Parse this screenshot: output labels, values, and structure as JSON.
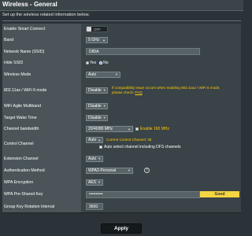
{
  "header": {
    "title": "Wireless - General"
  },
  "subtitle": "Set up the wireless related information below.",
  "rows": {
    "smart_connect": {
      "label": "Enable Smart Connect",
      "toggle_text": "OFF"
    },
    "band": {
      "label": "Band",
      "value": "5 GHz"
    },
    "ssid": {
      "label": "Network Name (SSID)",
      "value": "D85A"
    },
    "hide_ssid": {
      "label": "Hide SSID",
      "yes": "Yes",
      "no": "No",
      "selected": "No"
    },
    "wireless_mode": {
      "label": "Wireless Mode",
      "value": "Auto"
    },
    "wifi6": {
      "label": "802.11ax / WiFi 6 mode",
      "value": "Disable",
      "warning": "If compatibility issue occurs when enabling 802.11ax / WiFi 6 mode, please check:",
      "faq": "FAQ"
    },
    "multiband": {
      "label": "WiFi Agile Multiband",
      "value": "Disable"
    },
    "twt": {
      "label": "Target Wake Time",
      "value": "Disable"
    },
    "bandwidth": {
      "label": "Channel bandwidth",
      "value": "20/40/80 MHz",
      "checkbox_label": "Enable 160 MHz"
    },
    "channel": {
      "label": "Control Channel",
      "value": "Auto",
      "current": "Current Control Channel: 36",
      "dfs_label": "Auto select channel including DFS channels"
    },
    "ext_channel": {
      "label": "Extension Channel",
      "value": "Auto"
    },
    "auth": {
      "label": "Authentication Method",
      "value": "WPA2-Personal",
      "help": "?"
    },
    "encryption": {
      "label": "WPA Encryption",
      "value": "AES"
    },
    "psk": {
      "label": "WPA Pre-Shared Key",
      "value": "••••••••••",
      "strength": "Good"
    },
    "rotation": {
      "label": "Group Key Rotation Interval",
      "value": "3600"
    }
  },
  "apply_label": "Apply",
  "icons": {
    "dropdown": "chevron-down-icon",
    "help": "help-icon"
  },
  "colors": {
    "background": "#2b3338",
    "label_bg": "#4b5559",
    "warning": "#ffcc00",
    "strength_good": "#f4d542"
  }
}
